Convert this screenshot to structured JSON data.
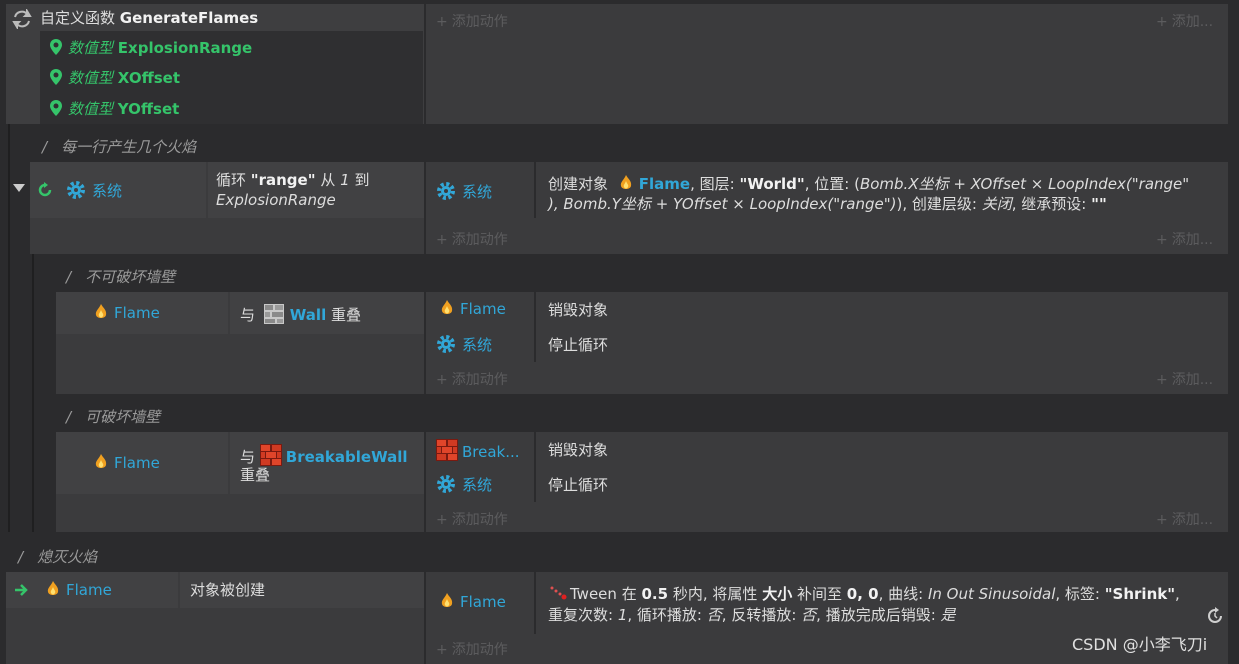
{
  "add_action_label": "添加动作",
  "add_action_short": "添加...",
  "function": {
    "keyword": "自定义函数",
    "name": "GenerateFlames",
    "params": [
      {
        "type": "数值型",
        "name": "ExplosionRange"
      },
      {
        "type": "数值型",
        "name": "XOffset"
      },
      {
        "type": "数值型",
        "name": "YOffset"
      }
    ]
  },
  "comments": {
    "rows_per_line": "每一行产生几个火焰",
    "unbreakable": "不可破坏墙壁",
    "breakable": "可破坏墙壁",
    "extinguish": "熄灭火焰"
  },
  "loop_event": {
    "system": "系统",
    "loop_prefix": "循环",
    "loop_var": "\"range\"",
    "from": "从",
    "start": "1",
    "to": "到",
    "end": "ExplosionRange",
    "action_object": "系统",
    "action_line1_a": "创建对象",
    "action_line1_obj": "Flame",
    "action_line1_b": ", 图层:",
    "action_line1_layer": "\"World\"",
    "action_line1_c": ", 位置: (",
    "action_line1_expr": "Bomb.X坐标 + XOffset × LoopIndex(\"range\"",
    "action_line2_expr": "), Bomb.Y坐标 + YOffset × LoopIndex(\"range\")",
    "action_line2_b": "), 创建层级:",
    "action_line2_level": "关闭",
    "action_line2_c": ", 继承预设:",
    "action_line2_preset": "\"\""
  },
  "wall_event": {
    "object": "Flame",
    "with": "与",
    "other": "Wall",
    "overlap": "重叠",
    "actions": [
      {
        "object": "Flame",
        "text": "销毁对象"
      },
      {
        "object": "系统",
        "text": "停止循环"
      }
    ]
  },
  "breakable_event": {
    "object": "Flame",
    "with": "与",
    "other": "BreakableWall",
    "overlap": "重叠",
    "actions": [
      {
        "object": "Break...",
        "text": "销毁对象"
      },
      {
        "object": "系统",
        "text": "停止循环"
      }
    ]
  },
  "created_event": {
    "object": "Flame",
    "condition": "对象被创建",
    "action_object": "Flame",
    "l1_a": "Tween",
    "l1_b": "在",
    "l1_time": "0.5",
    "l1_c": "秒内, 将属性",
    "l1_prop": "大小",
    "l1_d": "补间至",
    "l1_val": "0, 0",
    "l1_e": ", 曲线:",
    "l1_curve": "In Out Sinusoidal",
    "l1_f": ", 标签:",
    "l1_tag": "\"Shrink\"",
    "l1_g": ",",
    "l2_a": "重复次数:",
    "l2_rep": "1",
    "l2_b": ", 循环播放:",
    "l2_loop": "否",
    "l2_c": ", 反转播放:",
    "l2_rev": "否",
    "l2_d": ", 播放完成后销毁:",
    "l2_destroy": "是"
  },
  "watermark": "CSDN @小李飞刀i",
  "colors": {
    "object": "#31a7d8",
    "param": "#35c46a",
    "bg": "#2b2b2d",
    "panel": "#3b3b3d"
  }
}
